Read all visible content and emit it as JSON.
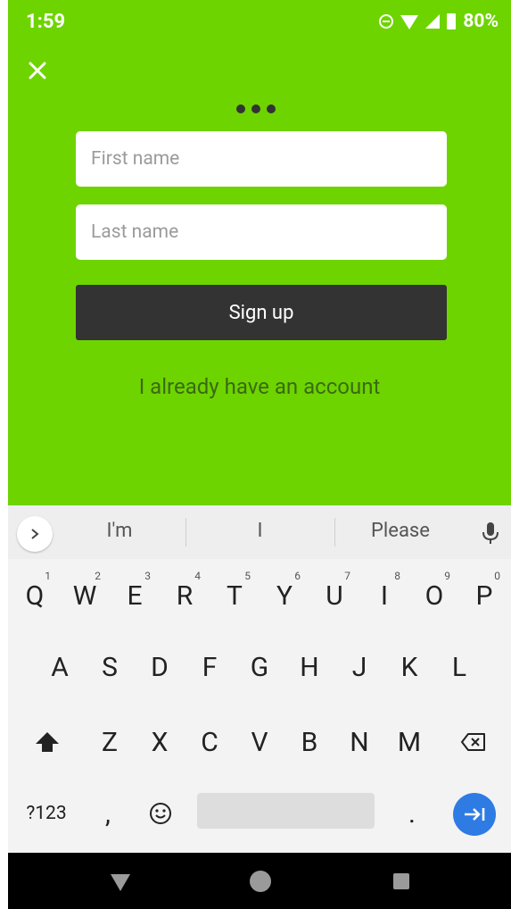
{
  "status_bar": {
    "time": "1:59",
    "battery": "80%"
  },
  "form": {
    "first_name_placeholder": "First name",
    "last_name_placeholder": "Last name",
    "signup_label": "Sign up",
    "have_account_label": "I already have an account"
  },
  "keyboard": {
    "suggestions": [
      "I'm",
      "I",
      "Please"
    ],
    "row1": [
      {
        "letter": "Q",
        "hint": "1"
      },
      {
        "letter": "W",
        "hint": "2"
      },
      {
        "letter": "E",
        "hint": "3"
      },
      {
        "letter": "R",
        "hint": "4"
      },
      {
        "letter": "T",
        "hint": "5"
      },
      {
        "letter": "Y",
        "hint": "6"
      },
      {
        "letter": "U",
        "hint": "7"
      },
      {
        "letter": "I",
        "hint": "8"
      },
      {
        "letter": "O",
        "hint": "9"
      },
      {
        "letter": "P",
        "hint": "0"
      }
    ],
    "row2": [
      "A",
      "S",
      "D",
      "F",
      "G",
      "H",
      "J",
      "K",
      "L"
    ],
    "row3": [
      "Z",
      "X",
      "C",
      "V",
      "B",
      "N",
      "M"
    ],
    "mode_label": "?123",
    "comma_label": ",",
    "period_label": "."
  },
  "colors": {
    "app_background": "#6dd400",
    "button_background": "#333333",
    "link_text": "#3b6a10",
    "enter_key": "#2f7be4"
  },
  "icons": {
    "close": "close-icon",
    "loading": "dots-icon",
    "mic": "mic-icon",
    "shift": "shift-icon",
    "backspace": "backspace-icon",
    "emoji": "emoji-icon",
    "enter": "next-arrow-icon"
  }
}
